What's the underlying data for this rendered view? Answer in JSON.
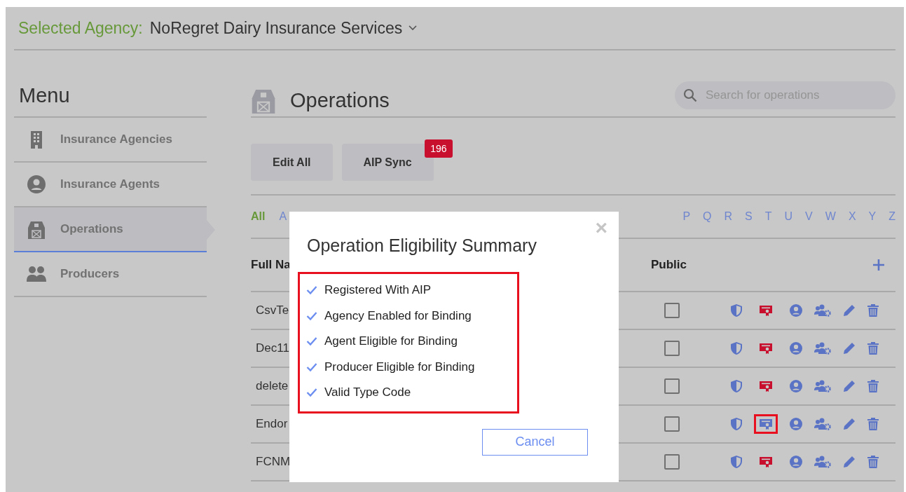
{
  "agency_bar": {
    "label": "Selected Agency:",
    "value": "NoRegret Dairy Insurance Services"
  },
  "menu": {
    "title": "Menu",
    "items": [
      {
        "label": "Insurance Agencies",
        "selected": false
      },
      {
        "label": "Insurance Agents",
        "selected": false
      },
      {
        "label": "Operations",
        "selected": true
      },
      {
        "label": "Producers",
        "selected": false
      }
    ]
  },
  "page": {
    "title": "Operations",
    "search": {
      "placeholder": "Search for operations"
    }
  },
  "actions": [
    {
      "label": "Edit All"
    },
    {
      "label": "AIP Sync",
      "badge": "196"
    }
  ],
  "letter_filter": [
    {
      "label": "All",
      "selected": true
    },
    {
      "label": "A",
      "selected": false
    },
    {
      "label": "P",
      "selected": false
    },
    {
      "label": "Q",
      "selected": false
    },
    {
      "label": "R",
      "selected": false
    },
    {
      "label": "S",
      "selected": false
    },
    {
      "label": "T",
      "selected": false
    },
    {
      "label": "U",
      "selected": false
    },
    {
      "label": "V",
      "selected": false
    },
    {
      "label": "W",
      "selected": false
    },
    {
      "label": "X",
      "selected": false
    },
    {
      "label": "Y",
      "selected": false
    },
    {
      "label": "Z",
      "selected": false
    }
  ],
  "table": {
    "columns": [
      "Full Na",
      "Public"
    ],
    "rows": [
      {
        "name": "CsvTe",
        "public": false,
        "alert": true,
        "highlighted": false
      },
      {
        "name": "Dec11",
        "public": false,
        "alert": true,
        "highlighted": false
      },
      {
        "name": "delete",
        "public": false,
        "alert": true,
        "highlighted": false
      },
      {
        "name": "Endor",
        "public": false,
        "alert": false,
        "highlighted": true
      },
      {
        "name": "FCNM",
        "public": false,
        "alert": true,
        "highlighted": false
      }
    ]
  },
  "dialog": {
    "title": "Operation Eligibility Summary",
    "close": "×",
    "checks": [
      {
        "label": "Registered With AIP",
        "checked": true
      },
      {
        "label": "Agency Enabled for Binding",
        "checked": true
      },
      {
        "label": "Agent Eligible for Binding",
        "checked": true
      },
      {
        "label": "Producer Eligible for Binding",
        "checked": true
      },
      {
        "label": "Valid Type Code",
        "checked": true
      }
    ],
    "buttons": [
      "Cancel"
    ]
  }
}
